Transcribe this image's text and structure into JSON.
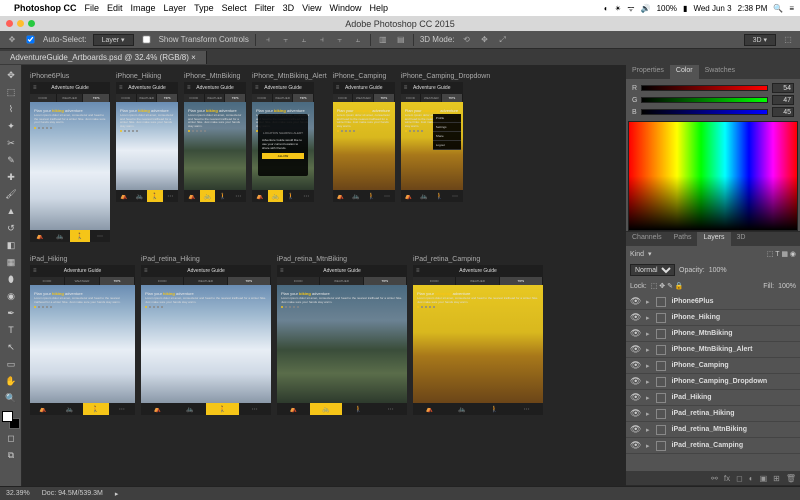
{
  "mac": {
    "app": "Photoshop CC",
    "menus": [
      "File",
      "Edit",
      "Image",
      "Layer",
      "Type",
      "Select",
      "Filter",
      "3D",
      "View",
      "Window",
      "Help"
    ],
    "battery": "100%",
    "date": "Wed Jun 3",
    "time": "2:38 PM"
  },
  "window_title": "Adobe Photoshop CC 2015",
  "options": {
    "auto_select_label": "Auto-Select:",
    "auto_select_target": "Layer",
    "show_transform_label": "Show Transform Controls",
    "mode_3d": "3D Mode:",
    "badge_3d": "3D"
  },
  "doc_tab": "AdventureGuide_Artboards.psd @ 32.4% (RGB/8)",
  "status": {
    "zoom": "32.39%",
    "doc": "Doc: 94.5M/539.3M"
  },
  "color": {
    "r": "54",
    "g": "47",
    "b": "45"
  },
  "layers_panel": {
    "tabs": [
      "Channels",
      "Paths",
      "Layers",
      "3D"
    ],
    "blend": "Normal",
    "opacity_label": "Opacity:",
    "opacity": "100%",
    "lock_label": "Lock:",
    "fill_label": "Fill:",
    "fill": "100%",
    "kind_label": "Kind"
  },
  "artboards": [
    {
      "id": "iPhone6Plus",
      "w": "phoneplus",
      "theme": "snow",
      "activity": "hiking",
      "title": "Adventure Guide"
    },
    {
      "id": "iPhone_Hiking",
      "w": "phone",
      "theme": "snow",
      "activity": "hiking",
      "title": "Adventure Guide"
    },
    {
      "id": "iPhone_MtnBiking",
      "w": "phone",
      "theme": "mtb",
      "activity": "biking",
      "title": "Adventure Guide"
    },
    {
      "id": "iPhone_MtnBiking_Alert",
      "w": "phone",
      "theme": "mtb",
      "activity": "biking",
      "title": "Adventure Guide",
      "alert": true
    },
    {
      "id": "iPhone_Camping",
      "w": "phone",
      "theme": "camp",
      "activity": "camping",
      "title": "Adventure Guide"
    },
    {
      "id": "iPhone_Camping_Dropdown",
      "w": "phone",
      "theme": "camp",
      "activity": "camping",
      "title": "Adventure Guide",
      "dropdown": true
    }
  ],
  "artboards2": [
    {
      "id": "iPad_Hiking",
      "w": "ipad",
      "theme": "snow",
      "activity": "hiking",
      "title": "Adventure Guide"
    },
    {
      "id": "iPad_retina_Hiking",
      "w": "ipadr",
      "theme": "snow",
      "activity": "hiking",
      "title": "Adventure Guide"
    },
    {
      "id": "iPad_retina_MtnBiking",
      "w": "ipadr",
      "theme": "mtb",
      "activity": "biking",
      "title": "Adventure Guide"
    },
    {
      "id": "iPad_retina_Camping",
      "w": "ipadr",
      "theme": "camp",
      "activity": "camping",
      "title": "Adventure Guide"
    }
  ],
  "layers": [
    "iPhone6Plus",
    "iPhone_Hiking",
    "iPhone_MtnBiking",
    "iPhone_MtnBiking_Alert",
    "iPhone_Camping",
    "iPhone_Camping_Dropdown",
    "iPad_Hiking",
    "iPad_retina_Hiking",
    "iPad_retina_MtnBiking",
    "iPad_retina_Camping"
  ],
  "mockup": {
    "tabs": [
      "FOOD",
      "WEATHER",
      "TIPS"
    ],
    "headline_pre": "Plan your ",
    "headline_post": " adventure",
    "sub": "Lorem ipsum dolor sit amet, consectetur and head to the nearest trailhead for a winter hike. Just make sure your hands stay warm.",
    "alert_title": "LOCATION SHARING ALERT",
    "alert_body": "Adventure Guide would like to use your current location to share with friends.",
    "alert_btn": "ALLOW",
    "dropdown": [
      "Profile",
      "Settings",
      "Share",
      "Logout"
    ]
  },
  "color_tabs": [
    "Properties",
    "Color",
    "Swatches"
  ]
}
